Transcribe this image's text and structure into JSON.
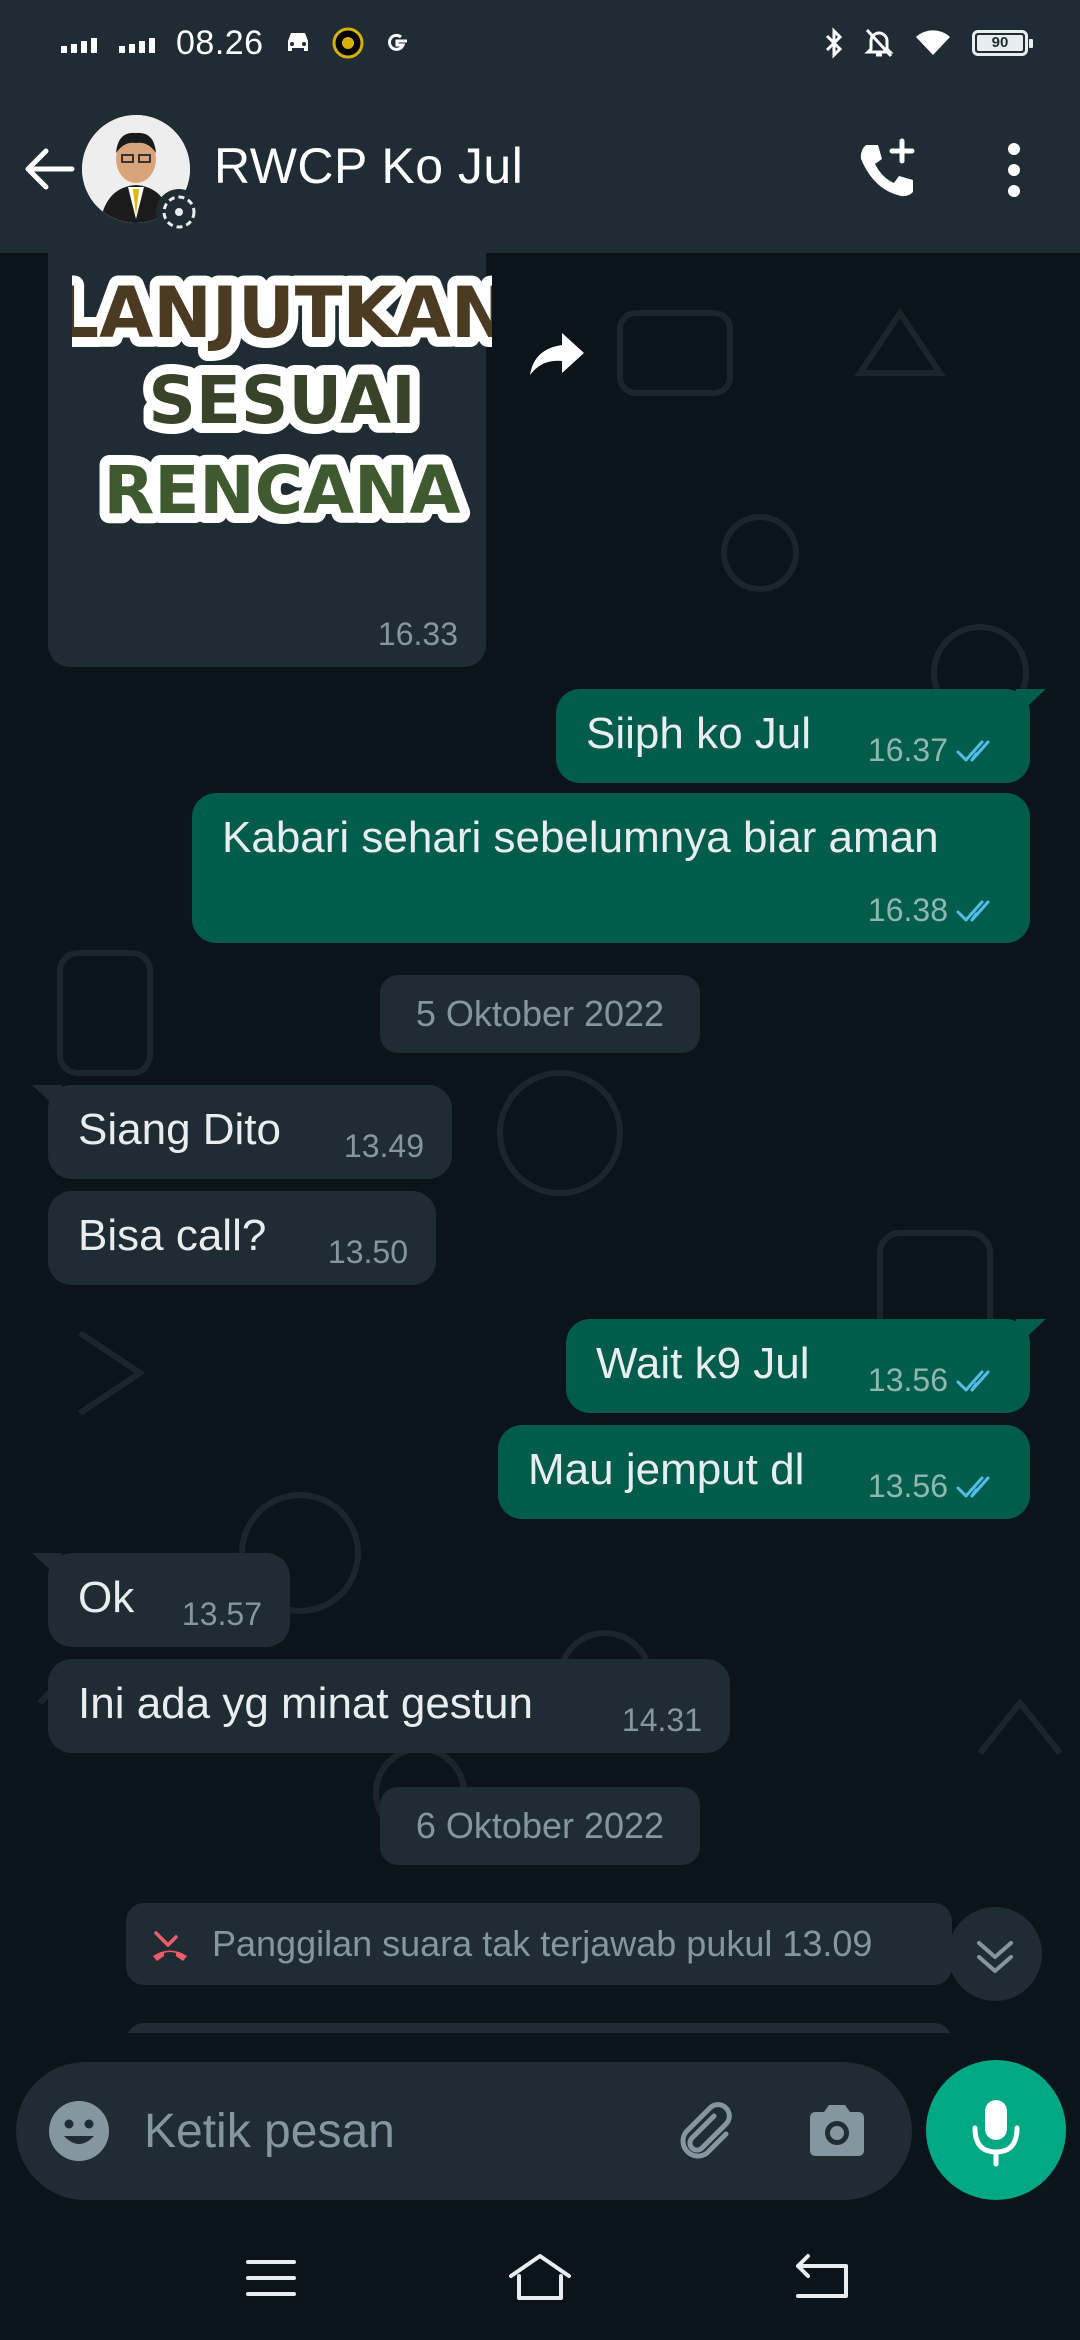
{
  "status_bar": {
    "time": "08.26",
    "battery": "90",
    "icons": [
      "signal-icon",
      "signal-icon",
      "car-icon",
      "app-notification-icon",
      "google-icon",
      "bluetooth-icon",
      "mute-bell-icon",
      "wifi-icon",
      "battery-icon"
    ]
  },
  "header": {
    "contact_name": "RWCP Ko Jul",
    "icons": [
      "back-arrow-icon",
      "avatar",
      "status-ring-icon",
      "add-call-icon",
      "more-vert-icon"
    ]
  },
  "chat": {
    "sticker": {
      "lines": [
        "LANJUTKAN",
        "SESUAI",
        "RENCANA"
      ],
      "time": "16.33"
    },
    "messages": [
      {
        "direction": "out",
        "text": "Siiph ko Jul",
        "time": "16.37",
        "read": true
      },
      {
        "direction": "out",
        "text": "Kabari sehari sebelumnya biar aman",
        "time": "16.38",
        "read": true
      },
      {
        "type": "date",
        "text": "5 Oktober 2022"
      },
      {
        "direction": "in",
        "text": "Siang Dito",
        "time": "13.49"
      },
      {
        "direction": "in",
        "text": "Bisa call?",
        "time": "13.50"
      },
      {
        "direction": "out",
        "text": "Wait k9 Jul",
        "time": "13.56",
        "read": true
      },
      {
        "direction": "out",
        "text": "Mau jemput dl",
        "time": "13.56",
        "read": true
      },
      {
        "direction": "in",
        "text": "Ok",
        "time": "13.57"
      },
      {
        "direction": "in",
        "text": "Ini ada yg minat gestun",
        "time": "14.31"
      },
      {
        "type": "date",
        "text": "6 Oktober 2022"
      },
      {
        "type": "missed_call",
        "text": "Panggilan suara tak terjawab pukul 13.09"
      }
    ]
  },
  "composer": {
    "placeholder": "Ketik pesan",
    "icons": [
      "emoji-icon",
      "attach-icon",
      "camera-icon",
      "mic-icon"
    ]
  },
  "nav_bar": {
    "icons": [
      "menu-icon",
      "home-icon",
      "back-icon"
    ]
  },
  "colors": {
    "background": "#0b141a",
    "header": "#1f2c34",
    "incoming_bubble": "#202c33",
    "outgoing_bubble": "#005c4b",
    "accent": "#00a884",
    "read_ticks": "#53bdeb",
    "missed_call": "#f15c6d"
  }
}
